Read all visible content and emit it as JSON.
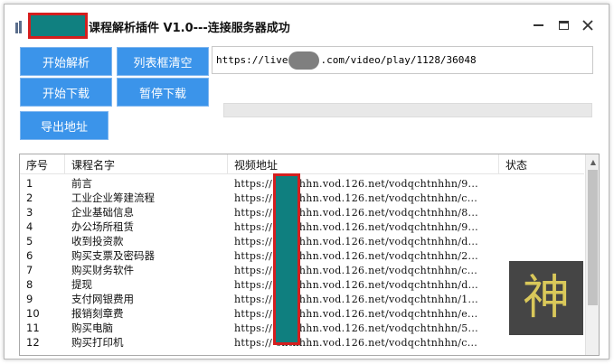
{
  "window": {
    "title": "课程解析插件 V1.0---连接服务器成功",
    "controls": {
      "minimize": "—",
      "maximize": "▭",
      "close": "✕"
    }
  },
  "toolbar": {
    "parse_label": "开始解析",
    "clear_label": "列表框清空",
    "download_label": "开始下载",
    "pause_label": "暂停下载",
    "export_label": "导出地址"
  },
  "url_input": {
    "prefix": "https://live",
    "suffix": ".com/video/play/1128/36048"
  },
  "table": {
    "columns": [
      "序号",
      "课程名字",
      "视频地址",
      "状态"
    ],
    "rows": [
      {
        "id": "1",
        "name": "前言",
        "url": "https://    chtnhhn.vod.126.net/vodqchtnhhn/9...",
        "status": ""
      },
      {
        "id": "2",
        "name": "工业企业筹建流程",
        "url": "https://    chtnhhn.vod.126.net/vodqchtnhhn/c...",
        "status": ""
      },
      {
        "id": "3",
        "name": "企业基础信息",
        "url": "https://    chtnhhn.vod.126.net/vodqchtnhhn/8...",
        "status": ""
      },
      {
        "id": "4",
        "name": "办公场所租赁",
        "url": "https://    chtnhhn.vod.126.net/vodqchtnhhn/9...",
        "status": ""
      },
      {
        "id": "5",
        "name": "收到投资款",
        "url": "https://    chtnhhn.vod.126.net/vodqchtnhhn/d...",
        "status": ""
      },
      {
        "id": "6",
        "name": "购买支票及密码器",
        "url": "https://    chtnhhn.vod.126.net/vodqchtnhhn/2...",
        "status": ""
      },
      {
        "id": "7",
        "name": "购买财务软件",
        "url": "https://    chtnhhn.vod.126.net/vodqchtnhhn/c...",
        "status": ""
      },
      {
        "id": "8",
        "name": "提现",
        "url": "https://    chtnhhn.vod.126.net/vodqchtnhhn/d...",
        "status": ""
      },
      {
        "id": "9",
        "name": "支付网银费用",
        "url": "https://    chtnhhn.vod.126.net/vodqchtnhhn/1...",
        "status": ""
      },
      {
        "id": "10",
        "name": "报销刻章费",
        "url": "https://    chtnhhn.vod.126.net/vodqchtnhhn/e...",
        "status": ""
      },
      {
        "id": "11",
        "name": "购买电脑",
        "url": "https://    chtnhhn.vod.126.net/vodqchtnhhn/5...",
        "status": ""
      },
      {
        "id": "12",
        "name": "购买打印机",
        "url": "https://    chtnhhn.vod.126.net/vodqchtnhhn/c...",
        "status": ""
      }
    ]
  },
  "badge": {
    "glyph": "神"
  },
  "colors": {
    "button": "#3b94ea",
    "redaction_fill": "#108080",
    "redaction_border": "#d51e1e",
    "badge_bg": "#454545",
    "badge_glyph": "#d9c85a"
  }
}
